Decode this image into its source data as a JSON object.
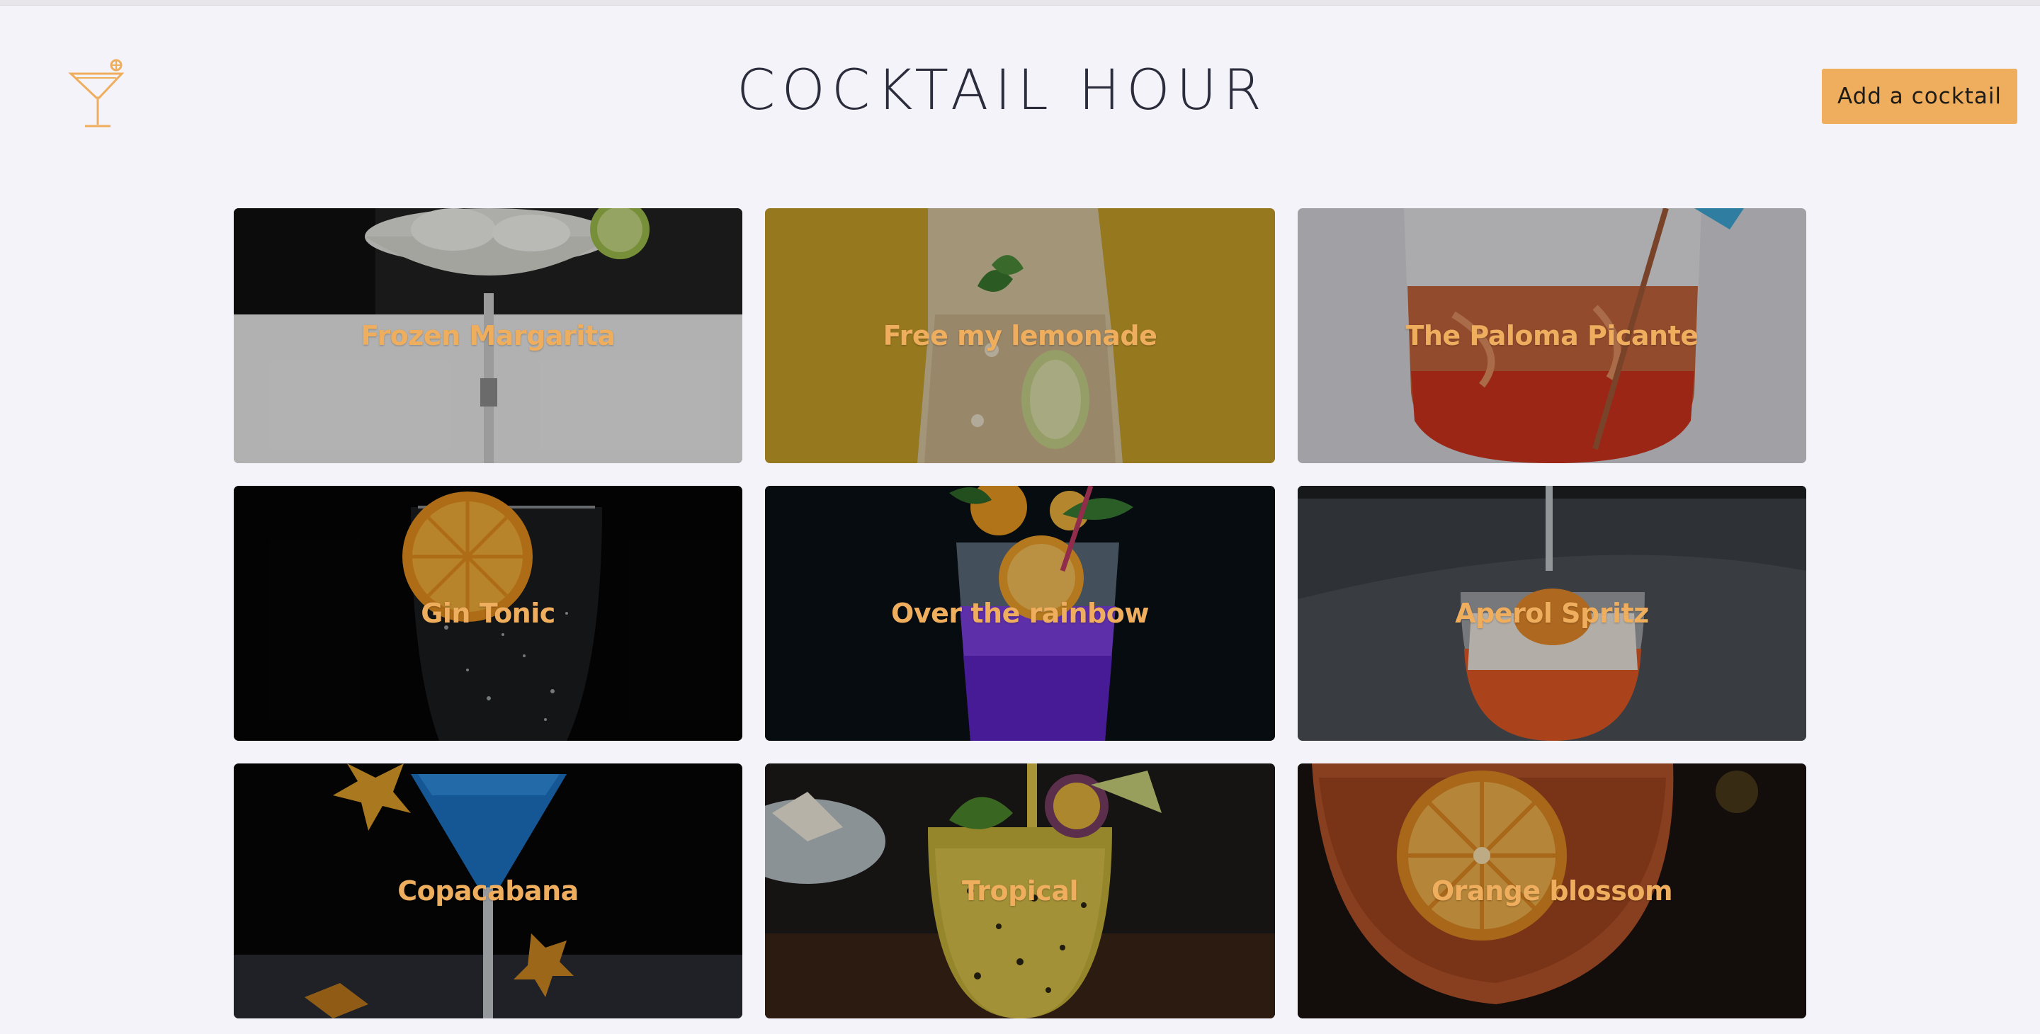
{
  "header": {
    "logo_icon": "cocktail-glass-icon",
    "title": "COCKTAIL HOUR",
    "add_button_label": "Add a cocktail"
  },
  "theme": {
    "accent": "#efae5e",
    "background": "#f5f3fa",
    "title_color": "#2b2d3d"
  },
  "cocktails": [
    {
      "name": "Frozen Margarita"
    },
    {
      "name": "Free my lemonade"
    },
    {
      "name": "The Paloma Picante"
    },
    {
      "name": "Gin Tonic"
    },
    {
      "name": "Over the rainbow"
    },
    {
      "name": "Aperol Spritz"
    },
    {
      "name": "Copacabana"
    },
    {
      "name": "Tropical"
    },
    {
      "name": "Orange blossom"
    }
  ]
}
